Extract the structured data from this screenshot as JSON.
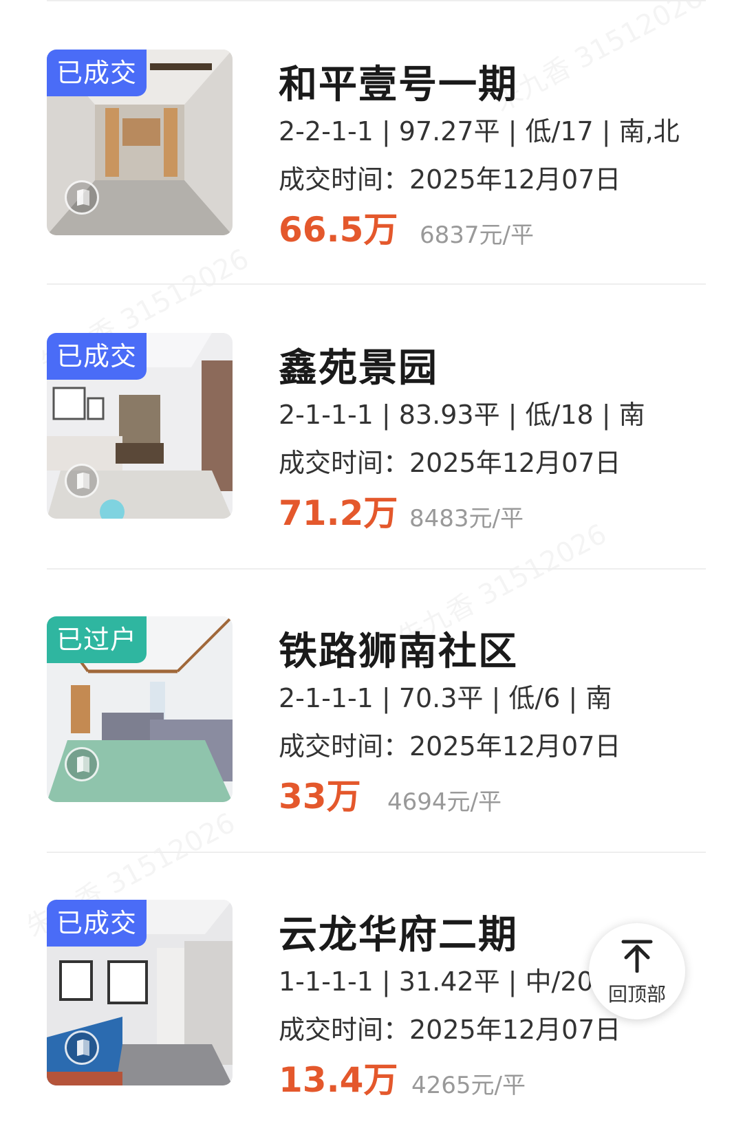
{
  "listings": [
    {
      "tag": "已成交",
      "tag_type": "sold",
      "title": "和平壹号一期",
      "specs": "2-2-1-1 | 97.27平 | 低/17 | 南,北",
      "deal_time": "成交时间：2025年12月07日",
      "price": "66.5万",
      "unit_price": "6837元/平"
    },
    {
      "tag": "已成交",
      "tag_type": "sold",
      "title": "鑫苑景园",
      "specs": "2-1-1-1 | 83.93平 | 低/18 | 南",
      "deal_time": "成交时间：2025年12月07日",
      "price": "71.2万",
      "unit_price": "8483元/平"
    },
    {
      "tag": "已过户",
      "tag_type": "transferred",
      "title": "铁路狮南社区",
      "specs": "2-1-1-1 | 70.3平 | 低/6 | 南",
      "deal_time": "成交时间：2025年12月07日",
      "price": "33万",
      "unit_price": "4694元/平"
    },
    {
      "tag": "已成交",
      "tag_type": "sold",
      "title": "云龙华府二期",
      "specs": "1-1-1-1 | 31.42平 | 中/20 |",
      "deal_time": "成交时间：2025年12月07日",
      "price": "13.4万",
      "unit_price": "4265元/平"
    }
  ],
  "back_to_top": {
    "label": "回顶部",
    "icon": "arrow-up-icon"
  },
  "watermark": "朱九香 31512026",
  "colors": {
    "price": "#e4582c",
    "tag_sold": "#4a6cf7",
    "tag_transferred": "#2fb6a0",
    "unit_price": "#999999"
  }
}
